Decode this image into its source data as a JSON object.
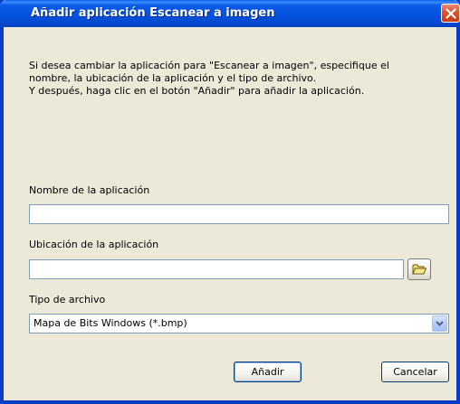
{
  "window": {
    "title": "Añadir aplicación Escanear a imagen"
  },
  "description": {
    "line1": "Si desea cambiar la aplicación para \"Escanear a imagen\", especifique el",
    "line2": "nombre, la ubicación de la aplicación y el tipo de archivo.",
    "line3": "Y después, haga clic en el botón \"Añadir\" para añadir la aplicación."
  },
  "fields": {
    "app_name_label": "Nombre de la aplicación",
    "app_name_value": "",
    "app_location_label": "Ubicación de la aplicación",
    "app_location_value": "",
    "file_type_label": "Tipo de archivo",
    "file_type_value": "Mapa de Bits Windows (*.bmp)"
  },
  "buttons": {
    "add_label": "Añadir",
    "cancel_label": "Cancelar"
  },
  "icons": {
    "close": "close-icon",
    "browse": "folder-icon",
    "dropdown": "chevron-down-icon"
  },
  "colors": {
    "titlebar": "#0551dc",
    "dialog_bg": "#ece9d8",
    "close_button": "#d9542e"
  }
}
